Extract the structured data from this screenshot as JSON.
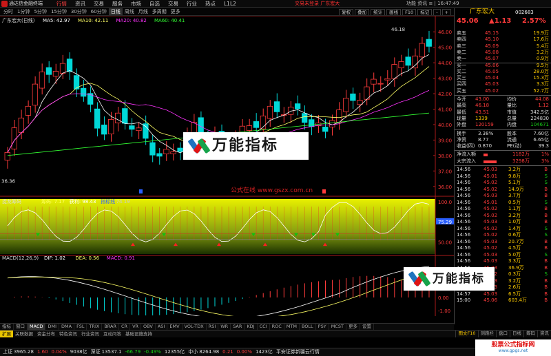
{
  "app": {
    "name": "通达信金融终端"
  },
  "menu": [
    "行情",
    "资讯",
    "交易",
    "服务",
    "市场",
    "自选",
    "交易",
    "行业",
    "热点",
    "L1L2"
  ],
  "menu_active": 0,
  "notice": "交易未登录    广东宏大",
  "top_right": {
    "labels": "功能  资讯  ≡  |  16:47:49"
  },
  "periods": [
    "分时",
    "1分钟",
    "5分钟",
    "15分钟",
    "30分钟",
    "60分钟",
    "日线",
    "周线",
    "月线",
    "多周期",
    "更多"
  ],
  "active_period": "日线",
  "toolbar": [
    "复权",
    "叠加",
    "统计",
    "画线",
    "F10",
    "标记",
    "-",
    "+"
  ],
  "chart": {
    "stock_label": "广东宏大(日线)",
    "ma_labels": [
      {
        "text": "MA5: 42.97",
        "color": "#ffffff"
      },
      {
        "text": "MA10: 42.11",
        "color": "#ffff66"
      },
      {
        "text": "MA20: 40.82",
        "color": "#ff33ff"
      },
      {
        "text": "MA60: 40.41",
        "color": "#33ff33"
      }
    ],
    "price_ticks": [
      "46.00",
      "45.00",
      "44.00",
      "43.00",
      "42.00",
      "41.00",
      "40.00",
      "39.00",
      "38.00",
      "37.00",
      "36.00"
    ],
    "high_label": "46.18",
    "low_label": "36.36",
    "gszx": "公式在线  www.gszx.com.cn",
    "indicator1": {
      "name": "捉龙筹码",
      "labels": [
        {
          "text": "筹码: 7.17",
          "color": "#ffff66"
        },
        {
          "text": "获利: 98.43",
          "color": "#ffffff"
        },
        {
          "text": "指标线",
          "color": "#2a5fff"
        },
        {
          "text": ": 74.19",
          "color": "#cccccc"
        }
      ],
      "ticks": [
        "100.0",
        "75.29",
        "50.00"
      ],
      "current": "75.29"
    },
    "indicator2": {
      "name": "MACD(12,26,9)",
      "labels": [
        {
          "text": "DIF: 1.02",
          "color": "#ffffff"
        },
        {
          "text": "DEA: 0.56",
          "color": "#ffff66"
        },
        {
          "text": "MACD: 0.91",
          "color": "#ff33ff"
        }
      ],
      "ticks": [
        "1.00",
        "0.00",
        "-1.00"
      ]
    },
    "date_labels": {
      "year": "2025年",
      "m10": "10",
      "m11": "11",
      "sel": "2025/11/06(四)",
      "m12": "12"
    }
  },
  "watermark": {
    "text": "万能指标"
  },
  "indicator_tabs": [
    "指标",
    "窗口",
    "MACD",
    "DMI",
    "DMA",
    "FSL",
    "TRIX",
    "BRAR",
    "CR",
    "VR",
    "OBV",
    "ASI",
    "EMV",
    "VOL-TDX",
    "RSI",
    "WR",
    "SAR",
    "KDJ",
    "CCI",
    "ROC",
    "MTM",
    "BOLL",
    "PSY",
    "MCST",
    "更多",
    "设置"
  ],
  "link_tabs": [
    "扩展",
    "关联数据",
    "资金分布",
    "特色资讯",
    "行业资讯",
    "互动问答",
    "基础设施支持"
  ],
  "rp_bottom_tabs": [
    "图文F10",
    "测跑栏",
    "盘口",
    "日线",
    "筹码",
    "资讯"
  ],
  "status": {
    "items": [
      {
        "label": "上证",
        "value": "3965.28",
        "color": "wt"
      },
      {
        "label": "",
        "value": "1.60",
        "color": "up"
      },
      {
        "label": "",
        "value": "0.04%",
        "color": "up"
      },
      {
        "label": "",
        "value": "9038亿",
        "color": "wt"
      },
      {
        "label": "深证",
        "value": "13537.1",
        "color": "wt"
      },
      {
        "label": "",
        "value": "-66.79",
        "color": "dn"
      },
      {
        "label": "",
        "value": "-0.49%",
        "color": "dn"
      },
      {
        "label": "",
        "value": "12355亿",
        "color": "wt"
      },
      {
        "label": "中小",
        "value": "8264.98",
        "color": "wt"
      },
      {
        "label": "",
        "value": "0.21",
        "color": "up"
      },
      {
        "label": "",
        "value": "0.00%",
        "color": "up"
      },
      {
        "label": "",
        "value": "1423亿",
        "color": "wt"
      },
      {
        "label": "",
        "value": "平安证券新疆云行情",
        "color": "wt"
      }
    ]
  },
  "brand_site": {
    "title": "股票公式指标网",
    "url": "www.gpgs.net"
  },
  "stock": {
    "name": "广东宏大",
    "code": "002683",
    "price": "45.06",
    "change": "▲1.13",
    "pct": "2.57%"
  },
  "order_book": [
    {
      "label": "卖五",
      "price": "45.15",
      "vol": "19.9万",
      "pc": "up"
    },
    {
      "label": "卖四",
      "price": "45.10",
      "vol": "17.6万",
      "pc": "up"
    },
    {
      "label": "卖三",
      "price": "45.09",
      "vol": "5.4万",
      "pc": "up"
    },
    {
      "label": "卖二",
      "price": "45.08",
      "vol": "3.2万",
      "pc": "up"
    },
    {
      "label": "卖一",
      "price": "45.07",
      "vol": "0.9万",
      "pc": "up"
    },
    {
      "label": "买一",
      "price": "45.06",
      "vol": "9.5万",
      "pc": "up"
    },
    {
      "label": "买二",
      "price": "45.05",
      "vol": "28.0万",
      "pc": "up"
    },
    {
      "label": "买三",
      "price": "45.04",
      "vol": "15.3万",
      "pc": "up"
    },
    {
      "label": "买四",
      "price": "45.03",
      "vol": "3.3万",
      "pc": "up"
    },
    {
      "label": "买五",
      "price": "45.02",
      "vol": "52.7万",
      "pc": "up"
    }
  ],
  "quote_rows": [
    [
      {
        "t": "今开",
        "c": "wt"
      },
      {
        "t": "43.00",
        "c": "up"
      },
      {
        "t": "均价",
        "c": "wt"
      },
      {
        "t": "44.08",
        "c": "up"
      }
    ],
    [
      {
        "t": "最高",
        "c": "wt"
      },
      {
        "t": "46.18",
        "c": "up"
      },
      {
        "t": "量比",
        "c": "wt"
      },
      {
        "t": "1.12",
        "c": "up"
      }
    ],
    [
      {
        "t": "最低",
        "c": "wt"
      },
      {
        "t": "43.51",
        "c": "up"
      },
      {
        "t": "市值",
        "c": "wt"
      },
      {
        "t": "342.5亿",
        "c": "wt"
      }
    ],
    [
      {
        "t": "现量",
        "c": "wt"
      },
      {
        "t": "1339",
        "c": "yl"
      },
      {
        "t": "总量",
        "c": "wt"
      },
      {
        "t": "224830",
        "c": "wt"
      }
    ],
    [
      {
        "t": "外盘",
        "c": "wt"
      },
      {
        "t": "120159",
        "c": "up"
      },
      {
        "t": "内盘",
        "c": "wt"
      },
      {
        "t": "104671",
        "c": "dn"
      }
    ]
  ],
  "finance_rows": [
    [
      {
        "t": "换手",
        "c": "wt"
      },
      {
        "t": "3.38%",
        "c": "wt"
      },
      {
        "t": "股本",
        "c": "wt"
      },
      {
        "t": "7.60亿",
        "c": "wt"
      }
    ],
    [
      {
        "t": "净资",
        "c": "wt"
      },
      {
        "t": "8.77",
        "c": "wt"
      },
      {
        "t": "流通",
        "c": "wt"
      },
      {
        "t": "6.65亿",
        "c": "wt"
      }
    ],
    [
      {
        "t": "收益(四)",
        "c": "wt"
      },
      {
        "t": "0.870",
        "c": "wt"
      },
      {
        "t": "PE(动)",
        "c": "wt"
      },
      {
        "t": "39.3",
        "c": "wt"
      }
    ]
  ],
  "flows": [
    {
      "label": "净流入额",
      "value": "1182万",
      "pct": "1%",
      "bar_fraction": 0.15
    },
    {
      "label": "大宗流入",
      "value": "3298万",
      "pct": "3%",
      "bar_fraction": 0.5
    }
  ],
  "ticks": [
    [
      "14:56",
      "45.03",
      "3.2万",
      "B"
    ],
    [
      "14:56",
      "45.01",
      "9.8万",
      "S"
    ],
    [
      "14:56",
      "45.02",
      "5.1万",
      "S"
    ],
    [
      "14:56",
      "45.02",
      "14.9万",
      "B"
    ],
    [
      "14:56",
      "45.03",
      "3.7万",
      "B"
    ],
    [
      "14:56",
      "45.01",
      "0.5万",
      "S"
    ],
    [
      "14:56",
      "45.02",
      "1.1万",
      "B"
    ],
    [
      "14:56",
      "45.02",
      "3.2万",
      "B"
    ],
    [
      "14:56",
      "45.03",
      "1.0万",
      "B"
    ],
    [
      "14:56",
      "45.02",
      "1.4万",
      "S"
    ],
    [
      "14:56",
      "45.02",
      "0.6万",
      "S"
    ],
    [
      "14:56",
      "45.03",
      "20.7万",
      "B"
    ],
    [
      "14:56",
      "45.02",
      "4.5万",
      "B"
    ],
    [
      "14:56",
      "45.03",
      "5.0万",
      "S"
    ],
    [
      "14:56",
      "45.03",
      "3.3万",
      "B"
    ],
    [
      "14:56",
      "45.03",
      "36.9万",
      "B"
    ],
    [
      "14:56",
      "45.02",
      "0.3万",
      "S"
    ],
    [
      "14:56",
      "45.03",
      "3.2万",
      "B"
    ],
    [
      "14:56",
      "45.03",
      "2.6万",
      "B"
    ],
    [
      "14:57",
      "45.03",
      "6.5万",
      "B"
    ],
    [
      "15:00",
      "45.06",
      "603.4万",
      "B"
    ]
  ],
  "colors": {
    "up": "#ff3b3b",
    "down": "#16d216",
    "ma5": "#ffffff",
    "ma10": "#ffff66",
    "ma20": "#ff33ff",
    "ma60": "#33ff33",
    "accent": "#ffcc00"
  }
}
